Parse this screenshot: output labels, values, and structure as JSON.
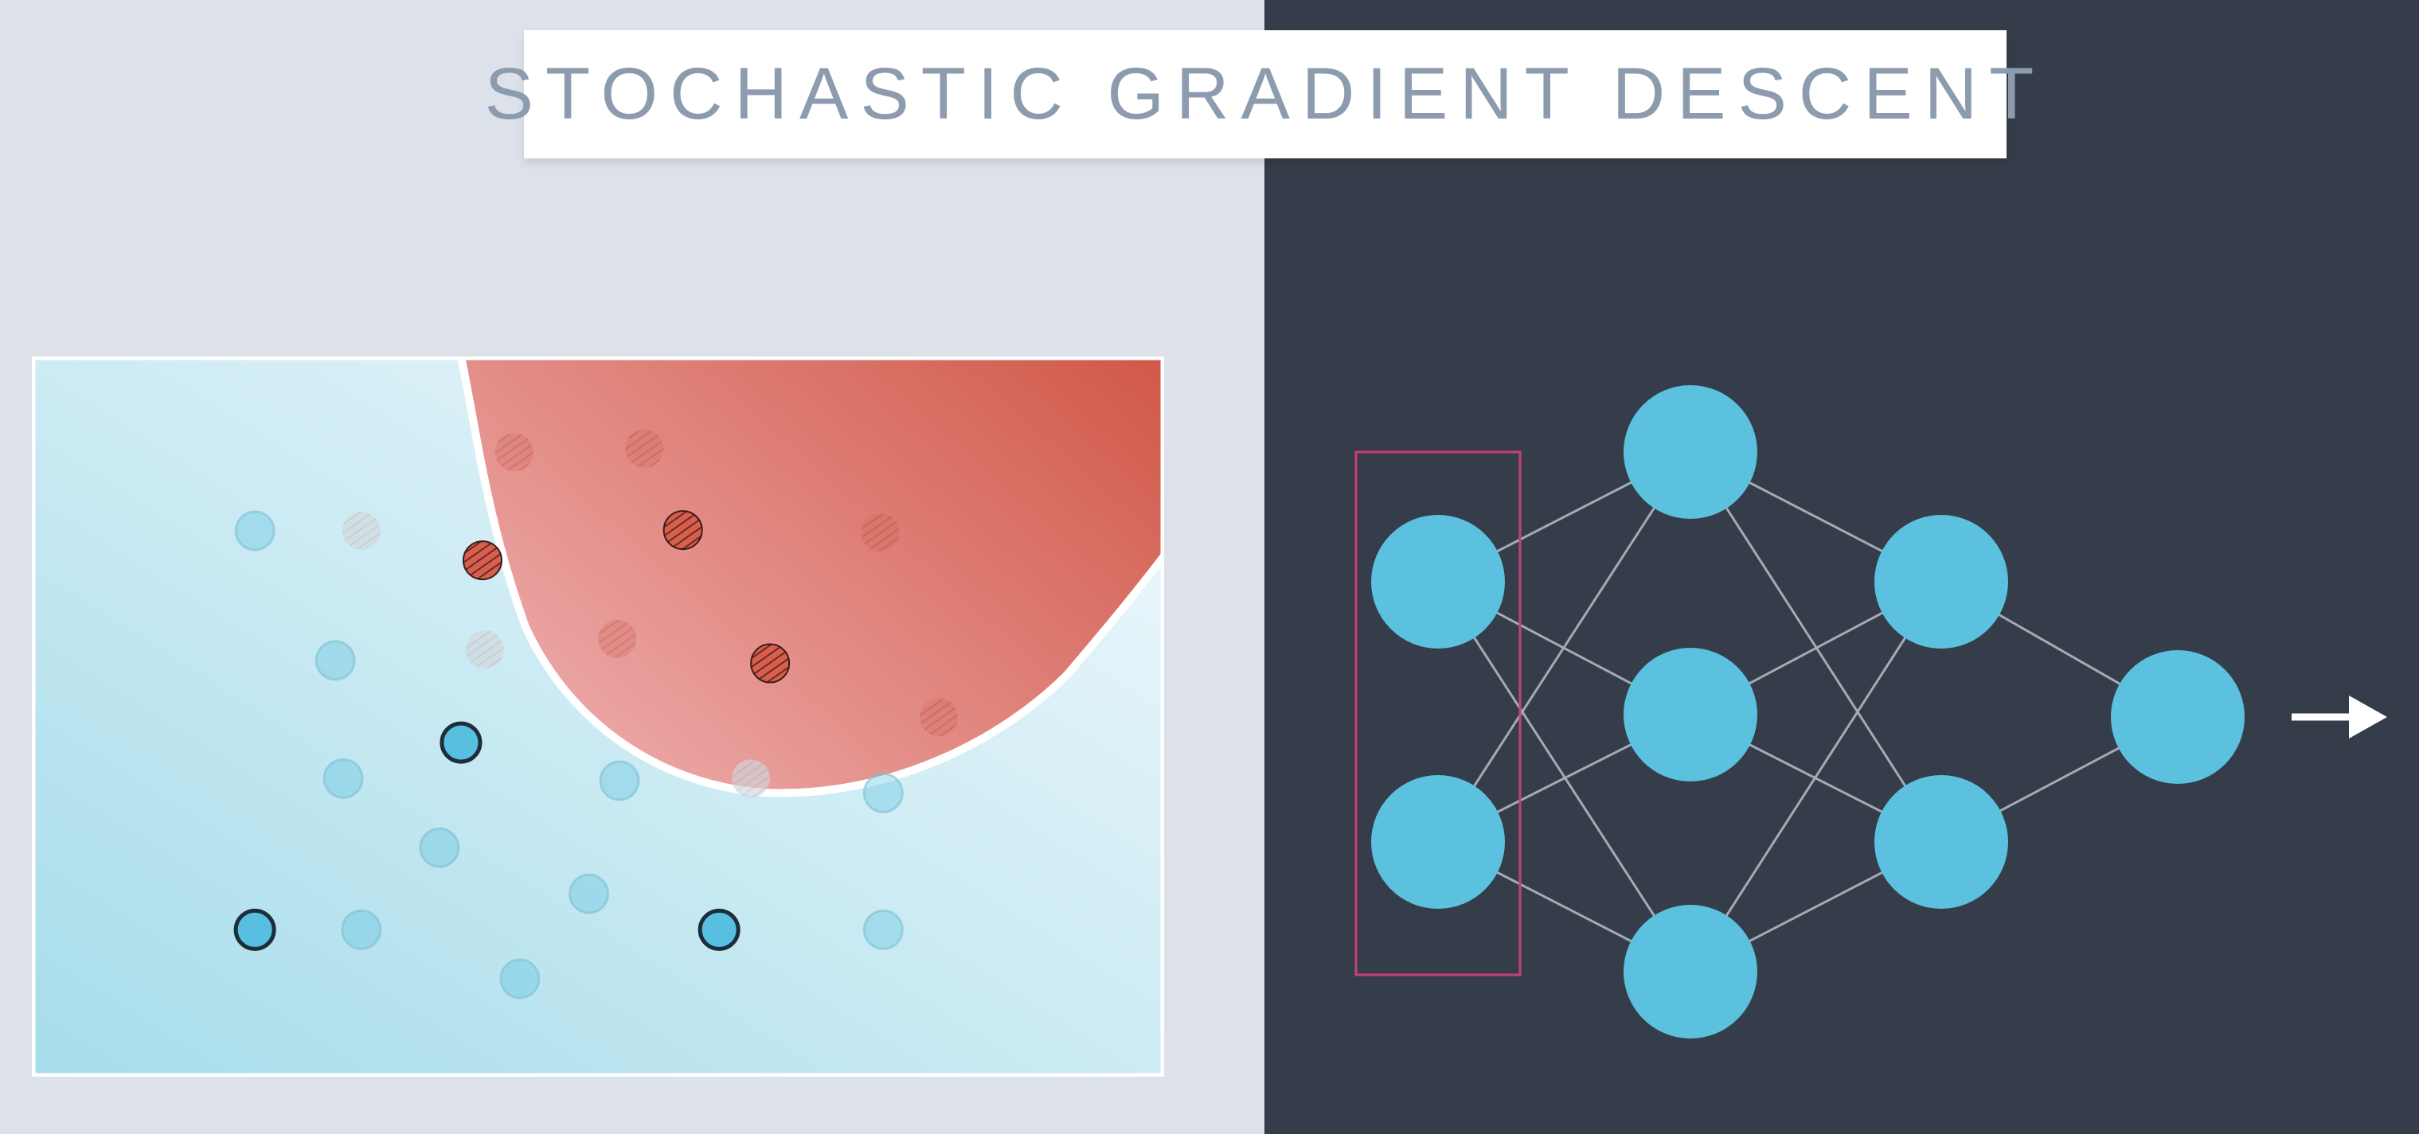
{
  "title": "STOCHASTIC GRADIENT DESCENT",
  "colors": {
    "left_background": "#dde2ea",
    "right_background": "#343d49",
    "title_text": "#8d9bae",
    "blue_region_light": "#f2fafd",
    "blue_region_dark": "#a6dcea",
    "red_region_light": "#eda9a8",
    "red_region_dark": "#d05747",
    "boundary": "#ffffff",
    "blue_point": "#58bfe0",
    "red_point": "#d95e4c",
    "node_fill": "#5bc1df",
    "edge": "#a4abb6",
    "highlight_box": "#cc3e78",
    "arrow": "#ffffff"
  },
  "plot": {
    "points": [
      {
        "x": 0.197,
        "y": 0.242,
        "cls": "blue",
        "active": false
      },
      {
        "x": 0.291,
        "y": 0.242,
        "cls": "gray",
        "active": false
      },
      {
        "x": 0.398,
        "y": 0.283,
        "cls": "red",
        "active": true
      },
      {
        "x": 0.426,
        "y": 0.133,
        "cls": "red",
        "active": false
      },
      {
        "x": 0.541,
        "y": 0.128,
        "cls": "red",
        "active": false
      },
      {
        "x": 0.575,
        "y": 0.241,
        "cls": "red",
        "active": true
      },
      {
        "x": 0.749,
        "y": 0.244,
        "cls": "red",
        "active": false
      },
      {
        "x": 0.268,
        "y": 0.422,
        "cls": "blue",
        "active": false
      },
      {
        "x": 0.4,
        "y": 0.407,
        "cls": "gray",
        "active": false
      },
      {
        "x": 0.517,
        "y": 0.392,
        "cls": "red",
        "active": false
      },
      {
        "x": 0.652,
        "y": 0.426,
        "cls": "red",
        "active": true
      },
      {
        "x": 0.379,
        "y": 0.536,
        "cls": "blue",
        "active": true
      },
      {
        "x": 0.275,
        "y": 0.586,
        "cls": "blue",
        "active": false
      },
      {
        "x": 0.519,
        "y": 0.589,
        "cls": "blue",
        "active": false
      },
      {
        "x": 0.635,
        "y": 0.586,
        "cls": "gray",
        "active": false
      },
      {
        "x": 0.801,
        "y": 0.501,
        "cls": "red",
        "active": false
      },
      {
        "x": 0.752,
        "y": 0.606,
        "cls": "blue",
        "active": false
      },
      {
        "x": 0.36,
        "y": 0.682,
        "cls": "blue",
        "active": false
      },
      {
        "x": 0.492,
        "y": 0.746,
        "cls": "blue",
        "active": false
      },
      {
        "x": 0.197,
        "y": 0.796,
        "cls": "blue",
        "active": true
      },
      {
        "x": 0.291,
        "y": 0.796,
        "cls": "blue",
        "active": false
      },
      {
        "x": 0.607,
        "y": 0.796,
        "cls": "blue",
        "active": true
      },
      {
        "x": 0.752,
        "y": 0.796,
        "cls": "blue",
        "active": false
      },
      {
        "x": 0.431,
        "y": 0.864,
        "cls": "blue",
        "active": false
      }
    ]
  },
  "network": {
    "layers": [
      [
        {
          "id": "in1"
        },
        {
          "id": "in2"
        }
      ],
      [
        {
          "id": "h1a"
        },
        {
          "id": "h1b"
        },
        {
          "id": "h1c"
        }
      ],
      [
        {
          "id": "h2a"
        },
        {
          "id": "h2b"
        }
      ],
      [
        {
          "id": "out"
        }
      ]
    ],
    "highlighted_layer": 0,
    "output_arrow": true
  }
}
